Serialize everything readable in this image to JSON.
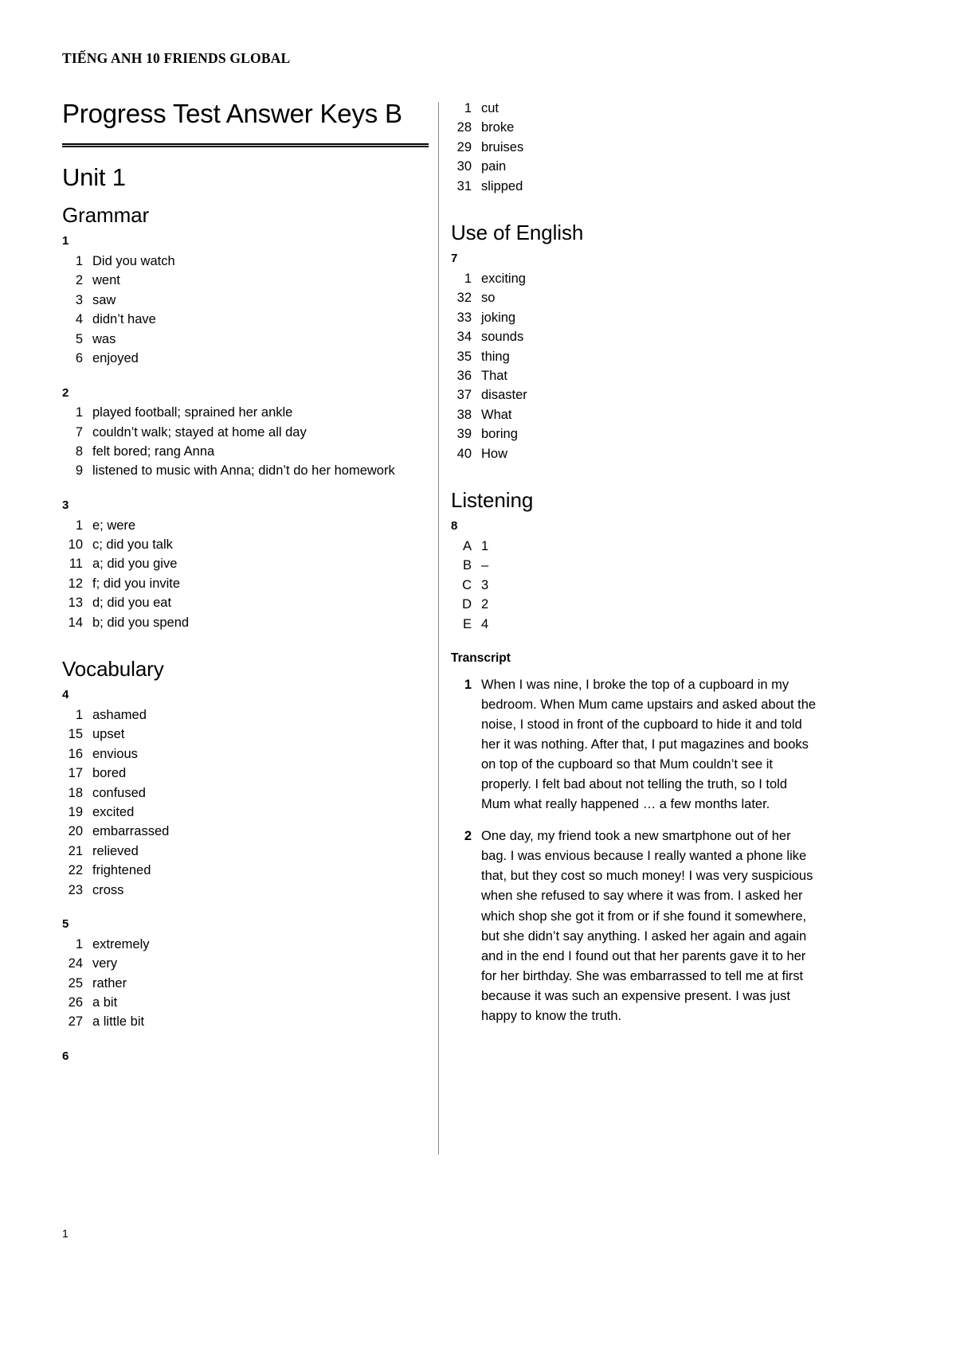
{
  "running_head": "TIẾNG ANH 10 FRIENDS GLOBAL",
  "doc_title": "Progress Test Answer Keys B",
  "unit_title": "Unit 1",
  "page_number": "1",
  "left_column": {
    "sections": [
      {
        "heading": "Grammar",
        "exercises": [
          {
            "number": "1",
            "answers": [
              {
                "marker": "1",
                "text": "Did you watch"
              },
              {
                "marker": "2",
                "text": "went"
              },
              {
                "marker": "3",
                "text": "saw"
              },
              {
                "marker": "4",
                "text": "didn’t have"
              },
              {
                "marker": "5",
                "text": "was"
              },
              {
                "marker": "6",
                "text": "enjoyed"
              }
            ]
          },
          {
            "number": "2",
            "answers": [
              {
                "marker": "1",
                "text": "played football; sprained her ankle"
              },
              {
                "marker": "7",
                "text": "couldn’t walk; stayed at home all day"
              },
              {
                "marker": "8",
                "text": "felt bored; rang Anna"
              },
              {
                "marker": "9",
                "text": "listened to music with Anna; didn’t do her homework"
              }
            ]
          },
          {
            "number": "3",
            "answers": [
              {
                "marker": "1",
                "text": "e; were"
              },
              {
                "marker": "10",
                "text": "c; did you talk"
              },
              {
                "marker": "11",
                "text": "a; did you give"
              },
              {
                "marker": "12",
                "text": "f; did you invite"
              },
              {
                "marker": "13",
                "text": "d; did you eat"
              },
              {
                "marker": "14",
                "text": "b; did you spend"
              }
            ]
          }
        ]
      },
      {
        "heading": "Vocabulary",
        "exercises": [
          {
            "number": "4",
            "answers": [
              {
                "marker": "1",
                "text": "ashamed"
              },
              {
                "marker": "15",
                "text": "upset"
              },
              {
                "marker": "16",
                "text": "envious"
              },
              {
                "marker": "17",
                "text": "bored"
              },
              {
                "marker": "18",
                "text": "confused"
              },
              {
                "marker": "19",
                "text": "excited"
              },
              {
                "marker": "20",
                "text": "embarrassed"
              },
              {
                "marker": "21",
                "text": "relieved"
              },
              {
                "marker": "22",
                "text": "frightened"
              },
              {
                "marker": "23",
                "text": "cross"
              }
            ]
          },
          {
            "number": "5",
            "answers": [
              {
                "marker": "1",
                "text": "extremely"
              },
              {
                "marker": "24",
                "text": "very"
              },
              {
                "marker": "25",
                "text": "rather"
              },
              {
                "marker": "26",
                "text": "a bit"
              },
              {
                "marker": "27",
                "text": "a little bit"
              }
            ]
          },
          {
            "number": "6",
            "answers": []
          }
        ]
      }
    ]
  },
  "right_column": {
    "continued_exercise": {
      "answers": [
        {
          "marker": "1",
          "text": "cut"
        },
        {
          "marker": "28",
          "text": "broke"
        },
        {
          "marker": "29",
          "text": "bruises"
        },
        {
          "marker": "30",
          "text": "pain"
        },
        {
          "marker": "31",
          "text": "slipped"
        }
      ]
    },
    "sections": [
      {
        "heading": "Use of English",
        "exercises": [
          {
            "number": "7",
            "answers": [
              {
                "marker": "1",
                "text": "exciting"
              },
              {
                "marker": "32",
                "text": "so"
              },
              {
                "marker": "33",
                "text": "joking"
              },
              {
                "marker": "34",
                "text": "sounds"
              },
              {
                "marker": "35",
                "text": "thing"
              },
              {
                "marker": "36",
                "text": "That"
              },
              {
                "marker": "37",
                "text": "disaster"
              },
              {
                "marker": "38",
                "text": "What"
              },
              {
                "marker": "39",
                "text": "boring"
              },
              {
                "marker": "40",
                "text": "How"
              }
            ]
          }
        ]
      },
      {
        "heading": "Listening",
        "exercises": [
          {
            "number": "8",
            "answers": [
              {
                "marker": "A",
                "text": "1"
              },
              {
                "marker": "B",
                "text": "–"
              },
              {
                "marker": "C",
                "text": "3"
              },
              {
                "marker": "D",
                "text": "2"
              },
              {
                "marker": "E",
                "text": "4"
              }
            ]
          }
        ]
      }
    ],
    "transcript": {
      "heading": "Transcript",
      "items": [
        {
          "number": "1",
          "text": "When I was nine, I broke the top of a cupboard in my bedroom. When Mum came upstairs and asked about the noise, I stood in front of the cupboard to hide it and told her it was nothing. After that, I put magazines and books on top of the cupboard so that Mum couldn’t see it properly. I felt bad about not telling the truth, so I told Mum what really happened … a few months later."
        },
        {
          "number": "2",
          "text": "One day, my friend took a new smartphone out of her bag. I was envious because I really wanted a phone like that, but they cost so much money! I was very suspicious when she refused to say where it was from. I asked her which shop she got it from or if she found it somewhere, but she didn’t say anything. I asked her again and again and in the end I found out that her parents gave it to her for her birthday. She was embarrassed to tell me at first because it was such an expensive present. I was just happy to know the truth."
        }
      ]
    }
  }
}
